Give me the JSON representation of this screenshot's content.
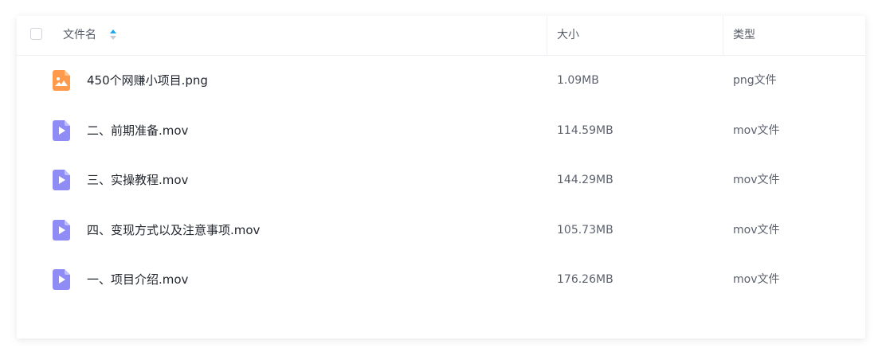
{
  "header": {
    "name_label": "文件名",
    "size_label": "大小",
    "type_label": "类型"
  },
  "colors": {
    "image_icon": "#ff9a4d",
    "video_icon": "#8f8cf6",
    "sort_active": "#1aa7f0"
  },
  "files": [
    {
      "name": "450个网赚小项目.png",
      "size": "1.09MB",
      "type": "png文件",
      "icon": "image-file-icon"
    },
    {
      "name": "二、前期准备.mov",
      "size": "114.59MB",
      "type": "mov文件",
      "icon": "video-file-icon"
    },
    {
      "name": "三、实操教程.mov",
      "size": "144.29MB",
      "type": "mov文件",
      "icon": "video-file-icon"
    },
    {
      "name": "四、变现方式以及注意事项.mov",
      "size": "105.73MB",
      "type": "mov文件",
      "icon": "video-file-icon"
    },
    {
      "name": "一、项目介绍.mov",
      "size": "176.26MB",
      "type": "mov文件",
      "icon": "video-file-icon"
    }
  ]
}
